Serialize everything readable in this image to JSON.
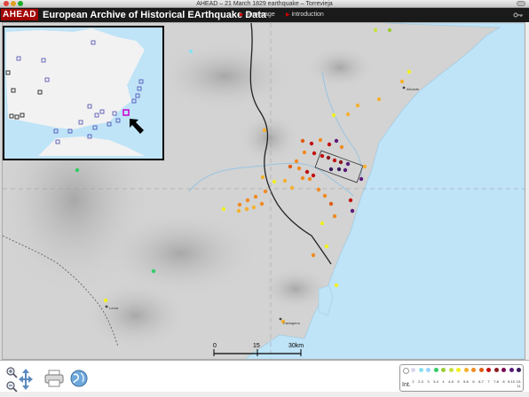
{
  "window": {
    "title": "AHEAD – 21 March 1829 earthquake – Torrevieja"
  },
  "header": {
    "logo": "AHEAD",
    "app_title": "European Archive of Historical EArthquake Data",
    "nav": [
      {
        "label": "homepage"
      },
      {
        "label": "introduction"
      }
    ]
  },
  "map": {
    "place_labels": [
      {
        "label": "Alicante"
      },
      {
        "label": "Cartagena"
      },
      {
        "label": "Lorca"
      }
    ],
    "scale": {
      "labels": [
        "0",
        "15",
        "30km"
      ]
    }
  },
  "legend": {
    "title": "Int.",
    "items": [
      {
        "label": "",
        "color": "#ffffff"
      },
      {
        "label": "2",
        "color": "#d8d8f0"
      },
      {
        "label": "2-3",
        "color": "#88e0f0"
      },
      {
        "label": "3",
        "color": "#9ad4ff"
      },
      {
        "label": "3-4",
        "color": "#33cc66"
      },
      {
        "label": "4",
        "color": "#99cc33"
      },
      {
        "label": "4-5",
        "color": "#c8e040"
      },
      {
        "label": "5",
        "color": "#f0f020"
      },
      {
        "label": "5-6",
        "color": "#f5b030"
      },
      {
        "label": "6",
        "color": "#f08a20"
      },
      {
        "label": "6-7",
        "color": "#e05a10"
      },
      {
        "label": "7",
        "color": "#c21010"
      },
      {
        "label": "7-8",
        "color": "#8a1a20"
      },
      {
        "label": "8",
        "color": "#7a0a50"
      },
      {
        "label": "9-10",
        "color": "#5a1a7a"
      },
      {
        "label": "10-11",
        "color": "#3a1a5a"
      }
    ]
  },
  "colors": {
    "accent_red": "#a30000",
    "header_bg": "#1a1a1a",
    "inset_marker": "#cc00cc"
  }
}
